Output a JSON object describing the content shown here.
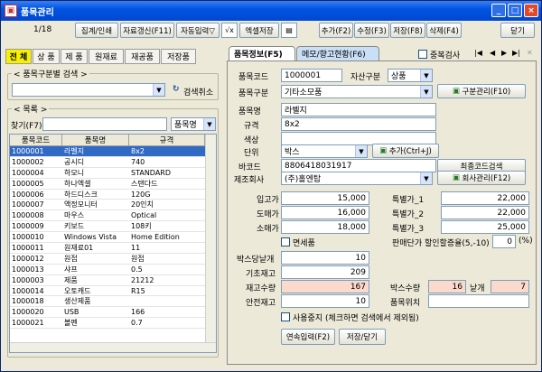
{
  "window": {
    "title": "품목관리"
  },
  "toolbar": {
    "page": "1/18",
    "buttons": [
      "집계/인쇄",
      "자료갱신(F11)",
      "자동입력▽",
      "엑셀저장",
      "추가(F2)",
      "수정(F3)",
      "저장(F8)",
      "삭제(F4)",
      "닫기"
    ]
  },
  "categories": [
    "전 체",
    "상 품",
    "제 품",
    "원재료",
    "재공품",
    "저장품"
  ],
  "left": {
    "group_label": "< 품목구분별 검색 >",
    "search_cancel": "검색취소",
    "list_label": "< 목록 >",
    "find_label": "찾기(F7)",
    "find_field": "품목명",
    "columns": [
      "품목코드",
      "품목명",
      "규격"
    ],
    "rows": [
      [
        "1000001",
        "라벨지",
        "8x2"
      ],
      [
        "1000002",
        "공시디",
        "740"
      ],
      [
        "1000004",
        "하모니",
        "STANDARD"
      ],
      [
        "1000005",
        "하나엑셀",
        "스탠다드"
      ],
      [
        "1000006",
        "하드디스크",
        "120G"
      ],
      [
        "1000007",
        "액정모니터",
        "20인치"
      ],
      [
        "1000008",
        "마우스",
        "Optical"
      ],
      [
        "1000009",
        "키보드",
        "108키"
      ],
      [
        "1000010",
        "Windows Vista",
        "Home Edition"
      ],
      [
        "1000011",
        "원재료01",
        "11"
      ],
      [
        "1000012",
        "원접",
        "원접"
      ],
      [
        "1000013",
        "샤프",
        "0.5"
      ],
      [
        "1000003",
        "제품",
        "21212"
      ],
      [
        "1000014",
        "오토캐드",
        "R15"
      ],
      [
        "1000018",
        "생산제품",
        ""
      ],
      [
        "1000020",
        "USB",
        "166"
      ],
      [
        "1000021",
        "볼펜",
        "0.7"
      ]
    ]
  },
  "tabs": [
    "품목정보(F5)",
    "메모/향고현황(F6)"
  ],
  "dup_check": "중복검사",
  "form": {
    "code_label": "품목코드",
    "code": "1000001",
    "asset_label": "자산구분",
    "asset": "상품",
    "type_label": "품목구분",
    "type": "기타소모품",
    "type_btn": "구분관리(F10)",
    "name_label": "품목명",
    "name": "라벨지",
    "spec_label": "규격",
    "spec": "8x2",
    "color_label": "색상",
    "color": "",
    "unit_label": "단위",
    "unit": "박스",
    "unit_btn": "추가(Ctrl+J)",
    "barcode_label": "바코드",
    "barcode": "8806418031917",
    "barcode_btn": "최종코드검색",
    "maker_label": "제조회사",
    "maker": "(주)홀엔탑",
    "maker_btn": "회사관리(F12)",
    "in_price_label": "입고가",
    "in_price": "15,000",
    "wholesale_label": "도매가",
    "wholesale": "16,000",
    "retail_label": "소매가",
    "retail": "18,000",
    "sp1_label": "특별가_1",
    "sp1": "22,000",
    "sp2_label": "특별가_2",
    "sp2": "22,000",
    "sp3_label": "특별가_3",
    "sp3": "25,000",
    "taxfree_label": "면세품",
    "discount_label": "판매단가 할인할증율(5,-10)",
    "discount": "0",
    "discount_unit": "(%)",
    "per_box_label": "박스당낱개",
    "per_box": "10",
    "base_stock_label": "기초재고",
    "base_stock": "209",
    "stock_label": "재고수량",
    "stock": "167",
    "box_qty_label": "박스수량",
    "box_qty": "16",
    "each_label": "낱개",
    "each": "7",
    "safe_label": "안전재고",
    "safe": "10",
    "location_label": "품목위치",
    "location": "",
    "stop_label": "사용중지 (체크하면 검색에서 제외됨)",
    "btn_continue": "연속입력(F2)",
    "btn_save_close": "저장/닫기"
  }
}
